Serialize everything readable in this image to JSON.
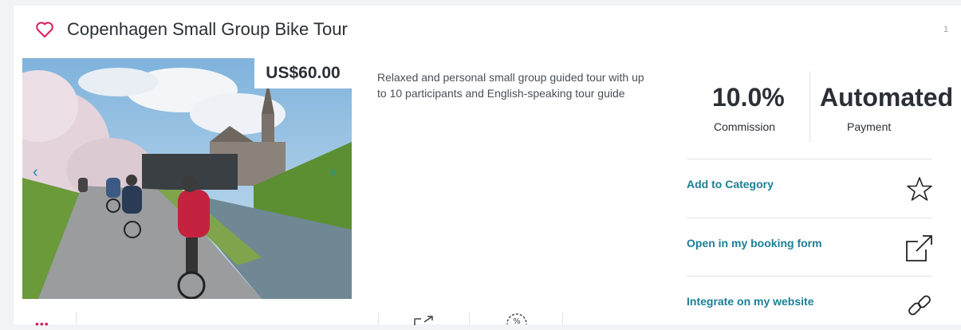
{
  "product": {
    "title": "Copenhagen Small Group Bike Tour",
    "price": "US$60.00",
    "description": "Relaxed and personal small group guided tour with up to 10 participants and English-speaking tour guide",
    "index": "1"
  },
  "stats": {
    "commission_value": "10.0%",
    "commission_label": "Commission",
    "payment_value": "Automated",
    "payment_label": "Payment"
  },
  "actions": [
    {
      "label": "Add to Category",
      "icon": "star-icon"
    },
    {
      "label": "Open in my booking form",
      "icon": "external-link-icon"
    },
    {
      "label": "Integrate on my website",
      "icon": "link-icon"
    }
  ],
  "colors": {
    "accent": "#1b7f96",
    "heart": "#d81b60",
    "carousel_arrow": "#1a8fbf"
  },
  "icons": [
    "heart-icon",
    "chevron-left-icon",
    "chevron-right-icon",
    "star-icon",
    "external-link-icon",
    "link-icon",
    "share-icon",
    "discount-badge-icon"
  ]
}
